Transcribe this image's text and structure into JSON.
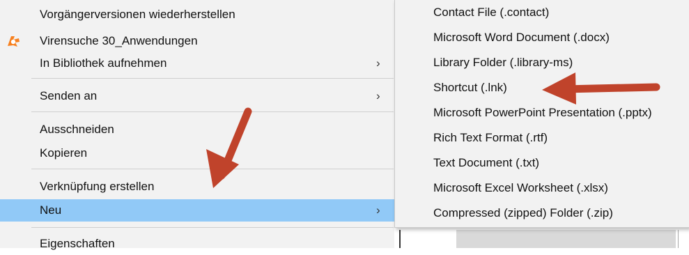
{
  "context_menu": {
    "items": [
      {
        "label": "Vorgängerversionen wiederherstellen"
      },
      {
        "label": "Virensuche 30_Anwendungen",
        "icon": "avast-icon"
      },
      {
        "label": "In Bibliothek aufnehmen",
        "submenu_chevron": "›"
      },
      {
        "label": "Senden an",
        "submenu_chevron": "›"
      },
      {
        "label": "Ausschneiden"
      },
      {
        "label": "Kopieren"
      },
      {
        "label": "Verknüpfung erstellen"
      },
      {
        "label": "Neu",
        "submenu_chevron": "›",
        "highlighted": true
      },
      {
        "label": "Eigenschaften"
      }
    ]
  },
  "new_submenu": {
    "items": [
      {
        "label": "Contact File (.contact)"
      },
      {
        "label": "Microsoft Word Document (.docx)"
      },
      {
        "label": "Library Folder (.library-ms)"
      },
      {
        "label": "Shortcut (.lnk)"
      },
      {
        "label": "Microsoft PowerPoint Presentation (.pptx)"
      },
      {
        "label": "Rich Text Format (.rtf)"
      },
      {
        "label": "Text Document (.txt)"
      },
      {
        "label": "Microsoft Excel Worksheet (.xlsx)"
      },
      {
        "label": "Compressed (zipped) Folder (.zip)"
      }
    ]
  },
  "colors": {
    "menu_bg": "#f2f2f2",
    "highlight": "#91c9f7",
    "annotation_arrow": "#c0432b",
    "avast_orange": "#f7801e"
  }
}
